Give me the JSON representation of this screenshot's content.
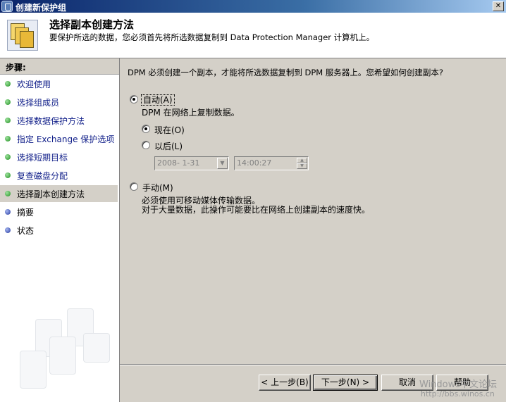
{
  "window": {
    "title": "创建新保护组",
    "close_glyph": "✕"
  },
  "header": {
    "title": "选择副本创建方法",
    "description": "要保护所选的数据，您必须首先将所选数据复制到 Data Protection Manager 计算机上。"
  },
  "sidebar": {
    "heading": "步骤:",
    "items": [
      {
        "label": "欢迎使用",
        "status": "done"
      },
      {
        "label": "选择组成员",
        "status": "done"
      },
      {
        "label": "选择数据保护方法",
        "status": "done"
      },
      {
        "label": "指定 Exchange 保护选项",
        "status": "done"
      },
      {
        "label": "选择短期目标",
        "status": "done"
      },
      {
        "label": "复查磁盘分配",
        "status": "done"
      },
      {
        "label": "选择副本创建方法",
        "status": "current"
      },
      {
        "label": "摘要",
        "status": "pending"
      },
      {
        "label": "状态",
        "status": "pending"
      }
    ]
  },
  "main": {
    "question": "DPM 必须创建一个副本，才能将所选数据复制到 DPM 服务器上。您希望如何创建副本?",
    "automatic": {
      "label": "自动(A)",
      "selected": true,
      "description": "DPM 在网络上复制数据。",
      "now": {
        "label": "现在(O)",
        "selected": true
      },
      "later": {
        "label": "以后(L)",
        "selected": false,
        "date": "2008- 1-31",
        "time": "14:00:27"
      }
    },
    "manual": {
      "label": "手动(M)",
      "selected": false,
      "description_line1": "必须使用可移动媒体传输数据。",
      "description_line2": "对于大量数据，此操作可能要比在网络上创建副本的速度快。"
    }
  },
  "footer": {
    "back": "< 上一步(B)",
    "next": "下一步(N) >",
    "cancel": "取消",
    "help": "帮助"
  },
  "watermark": {
    "text": "Windows中文论坛",
    "url": "http://bbs.winos.cn"
  },
  "colors": {
    "done_dot": "#1f8f1f",
    "pending_dot": "#2338a0",
    "link_text": "#12208a"
  }
}
